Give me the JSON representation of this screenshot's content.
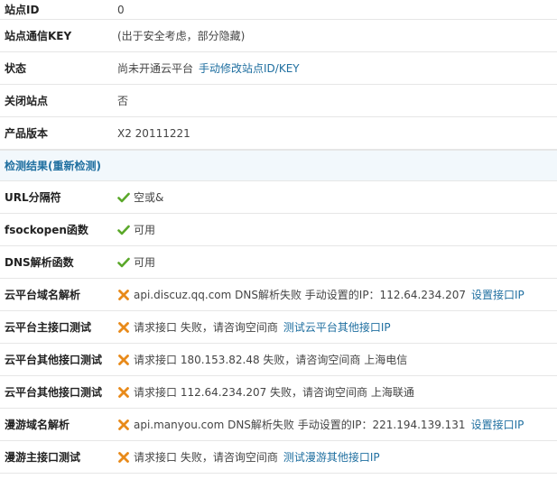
{
  "info": {
    "site_id_label": "站点ID",
    "site_id_value": "0",
    "key_label": "站点通信KEY",
    "key_value": "(出于安全考虑，部分隐藏)",
    "status_label": "状态",
    "status_value": "尚未开通云平台",
    "status_link": "手动修改站点ID/KEY",
    "close_label": "关闭站点",
    "close_value": "否",
    "version_label": "产品版本",
    "version_value": "X2 20111221"
  },
  "section_title": "检测结果(重新检测)",
  "checks": [
    {
      "label": "URL分隔符",
      "status": "ok",
      "text": "空或&",
      "link": ""
    },
    {
      "label": "fsockopen函数",
      "status": "ok",
      "text": "可用",
      "link": ""
    },
    {
      "label": "DNS解析函数",
      "status": "ok",
      "text": "可用",
      "link": ""
    },
    {
      "label": "云平台域名解析",
      "status": "fail",
      "text": "api.discuz.qq.com DNS解析失败 手动设置的IP：112.64.234.207",
      "link": "设置接口IP"
    },
    {
      "label": "云平台主接口测试",
      "status": "fail",
      "text": "请求接口 失败，请咨询空间商",
      "link": "测试云平台其他接口IP"
    },
    {
      "label": "云平台其他接口测试",
      "status": "fail",
      "text": "请求接口 180.153.82.48 失败，请咨询空间商 上海电信",
      "link": ""
    },
    {
      "label": "云平台其他接口测试",
      "status": "fail",
      "text": "请求接口 112.64.234.207 失败，请咨询空间商 上海联通",
      "link": ""
    },
    {
      "label": "漫游域名解析",
      "status": "fail",
      "text": "api.manyou.com DNS解析失败 手动设置的IP：221.194.139.131",
      "link": "设置接口IP"
    },
    {
      "label": "漫游主接口测试",
      "status": "fail",
      "text": "请求接口 失败，请咨询空间商",
      "link": "测试漫游其他接口IP"
    }
  ],
  "colors": {
    "link": "#1f6fa0",
    "ok": "#5aa82a",
    "fail": "#e88a1a",
    "section_bg": "#f2f8fc"
  },
  "icons": {
    "ok": "checkmark-icon",
    "fail": "cross-icon"
  }
}
